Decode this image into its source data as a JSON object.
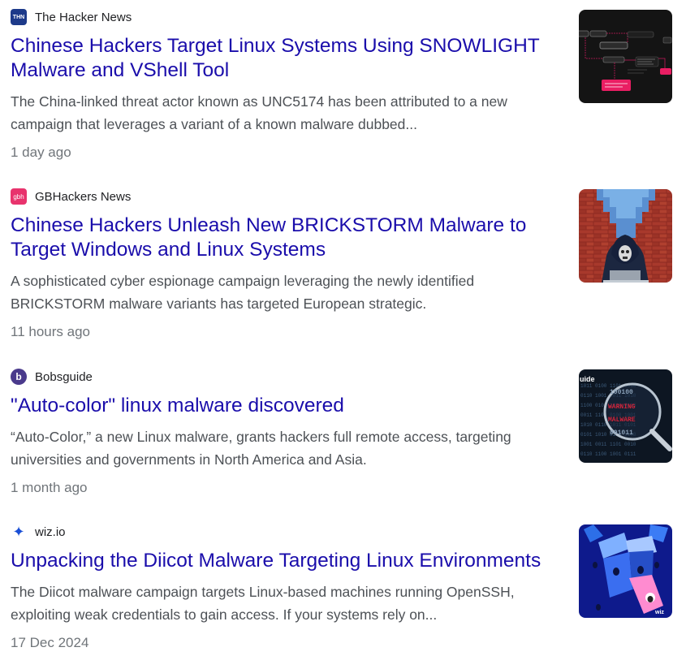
{
  "results": [
    {
      "source": "The Hacker News",
      "favicon_text": "THN",
      "favicon_color": "#1d3a8a",
      "title": "Chinese Hackers Target Linux Systems Using SNOWLIGHT Malware and VShell Tool",
      "snippet": "The China-linked threat actor known as UNC5174 has been attributed to a new campaign that leverages a variant of a known malware dubbed...",
      "time": "1 day ago"
    },
    {
      "source": "GBHackers News",
      "favicon_text": "gbh",
      "favicon_color": "#e8336d",
      "title": "Chinese Hackers Unleash New BRICKSTORM Malware to Target Windows and Linux Systems",
      "snippet": "A sophisticated cyber espionage campaign leveraging the newly identified BRICKSTORM malware variants has targeted European strategic.",
      "time": "11 hours ago"
    },
    {
      "source": "Bobsguide",
      "favicon_text": "b",
      "favicon_color": "#4a3a8c",
      "title": "\"Auto-color\" linux malware discovered",
      "snippet": "“Auto-Color,” a new Linux malware, grants hackers full remote access, targeting universities and governments in North America and Asia.",
      "time": "1 month ago",
      "thumb_text": "uide"
    },
    {
      "source": "wiz.io",
      "favicon_text": "✦",
      "favicon_color": "#1a4fd6",
      "title": "Unpacking the Diicot Malware Targeting Linux Environments",
      "snippet": "The Diicot malware campaign targets Linux-based machines running OpenSSH, exploiting weak credentials to gain access. If your systems rely on...",
      "time": "17 Dec 2024",
      "thumb_text": "wiz"
    }
  ]
}
